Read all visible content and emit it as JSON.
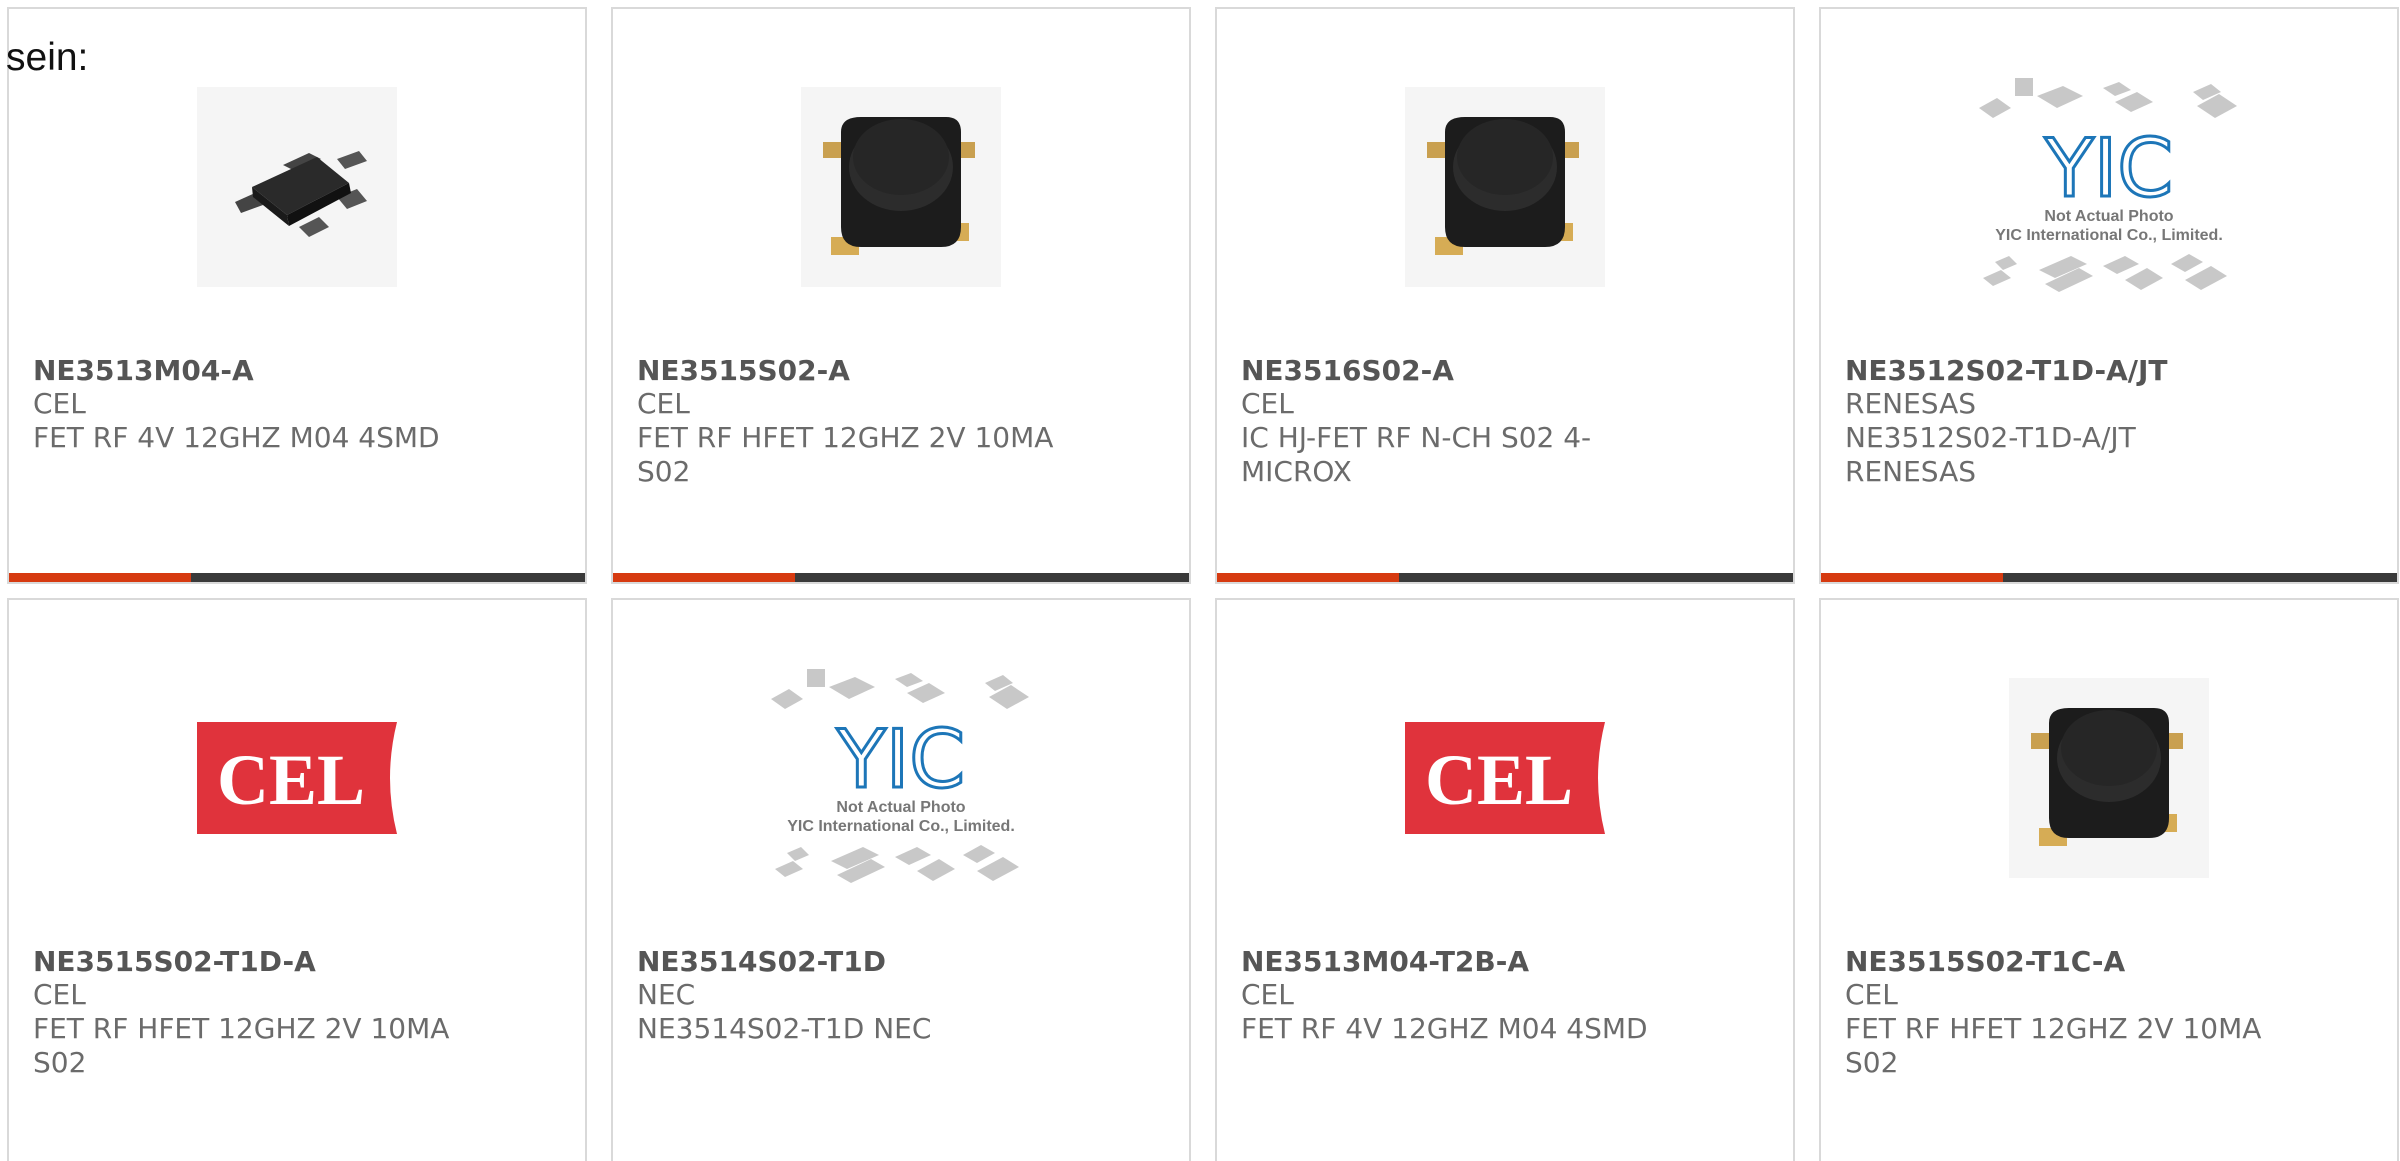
{
  "lead": {
    "text": "sein:"
  },
  "products": [
    {
      "part": "NE3513M04-A",
      "maker": "CEL",
      "desc": "FET RF 4V 12GHZ M04 4SMD",
      "image": "m04-package-icon"
    },
    {
      "part": "NE3515S02-A",
      "maker": "CEL",
      "desc": "FET RF HFET 12GHZ 2V 10MA S02",
      "image": "s02-package-icon"
    },
    {
      "part": "NE3516S02-A",
      "maker": "CEL",
      "desc": "IC HJ-FET RF N-CH S02 4-MICROX",
      "image": "s02-package-icon"
    },
    {
      "part": "NE3512S02-T1D-A/JT",
      "maker": "RENESAS",
      "desc": "NE3512S02-T1D-A/JT RENESAS",
      "image": "yic-placeholder-icon"
    },
    {
      "part": "NE3515S02-T1D-A",
      "maker": "CEL",
      "desc": "FET RF HFET 12GHZ 2V 10MA S02",
      "image": "cel-logo-icon"
    },
    {
      "part": "NE3514S02-T1D",
      "maker": "NEC",
      "desc": "NE3514S02-T1D NEC",
      "image": "yic-placeholder-icon"
    },
    {
      "part": "NE3513M04-T2B-A",
      "maker": "CEL",
      "desc": "FET RF 4V 12GHZ M04 4SMD",
      "image": "cel-logo-icon"
    },
    {
      "part": "NE3515S02-T1C-A",
      "maker": "CEL",
      "desc": "FET RF HFET 12GHZ 2V 10MA S02",
      "image": "s02-package-icon"
    }
  ],
  "logos": {
    "cel_text": "CEL",
    "yic_mark": "YIC",
    "yic_line1": "Not Actual Photo",
    "yic_line2": "YIC International Co., Limited."
  },
  "colors": {
    "accent": "#d63a10",
    "bar": "#3a3a3a",
    "cel_red": "#e0333c",
    "yic_blue": "#1d76b8"
  }
}
